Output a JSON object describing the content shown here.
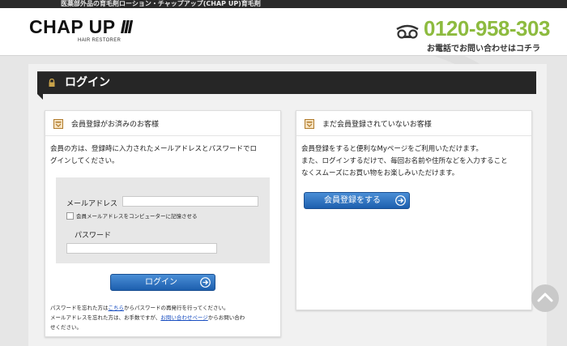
{
  "top_strip": {
    "text": "医薬部外品の育毛剤ローション・チャップアップ(CHAP UP)育毛剤"
  },
  "header": {
    "logo_text": "CHAP UP",
    "logo_bars": "III",
    "logo_sub": "HAIR RESTORER",
    "phone": "0120-958-303",
    "phone_note": "お電話でお問い合わせはコチラ",
    "accent_color": "#8dbb3f"
  },
  "page": {
    "title": "ログイン",
    "title_icon": "lock-icon"
  },
  "left_panel": {
    "heading": "会員登録がお済みのお客様",
    "desc_lines": [
      "会員の方は、登録時に入力されたメールアドレスとパスワードでロ",
      "グインしてください。"
    ],
    "email_label": "メールアドレス",
    "email_value": "",
    "remember_label": "会員メールアドレスをコンピューターに記憶させる",
    "password_label": "パスワード",
    "password_value": "",
    "login_button": "ログイン",
    "note_pw_prefix": "パスワードを忘れた方は",
    "note_pw_link": "こちら",
    "note_pw_suffix": "からパスワードの再発行を行ってください。",
    "note_mail_prefix": "メールアドレスを忘れた方は、お手数ですが、",
    "note_mail_link": "お問い合わせページ",
    "note_mail_suffix": "からお問い合わ",
    "note_mail_last": "せください。"
  },
  "right_panel": {
    "heading": "まだ会員登録されていないお客様",
    "desc_lines": [
      "会員登録をすると便利なMyページをご利用いただけます。",
      "また、ログインするだけで、毎回お名前や住所などを入力すること",
      "なくスムーズにお買い物をお楽しみいただけます。"
    ],
    "register_button": "会員登録をする"
  },
  "colors": {
    "button_blue": "#2a6cbf",
    "title_bar": "#262626",
    "link": "#1a4fc1"
  }
}
